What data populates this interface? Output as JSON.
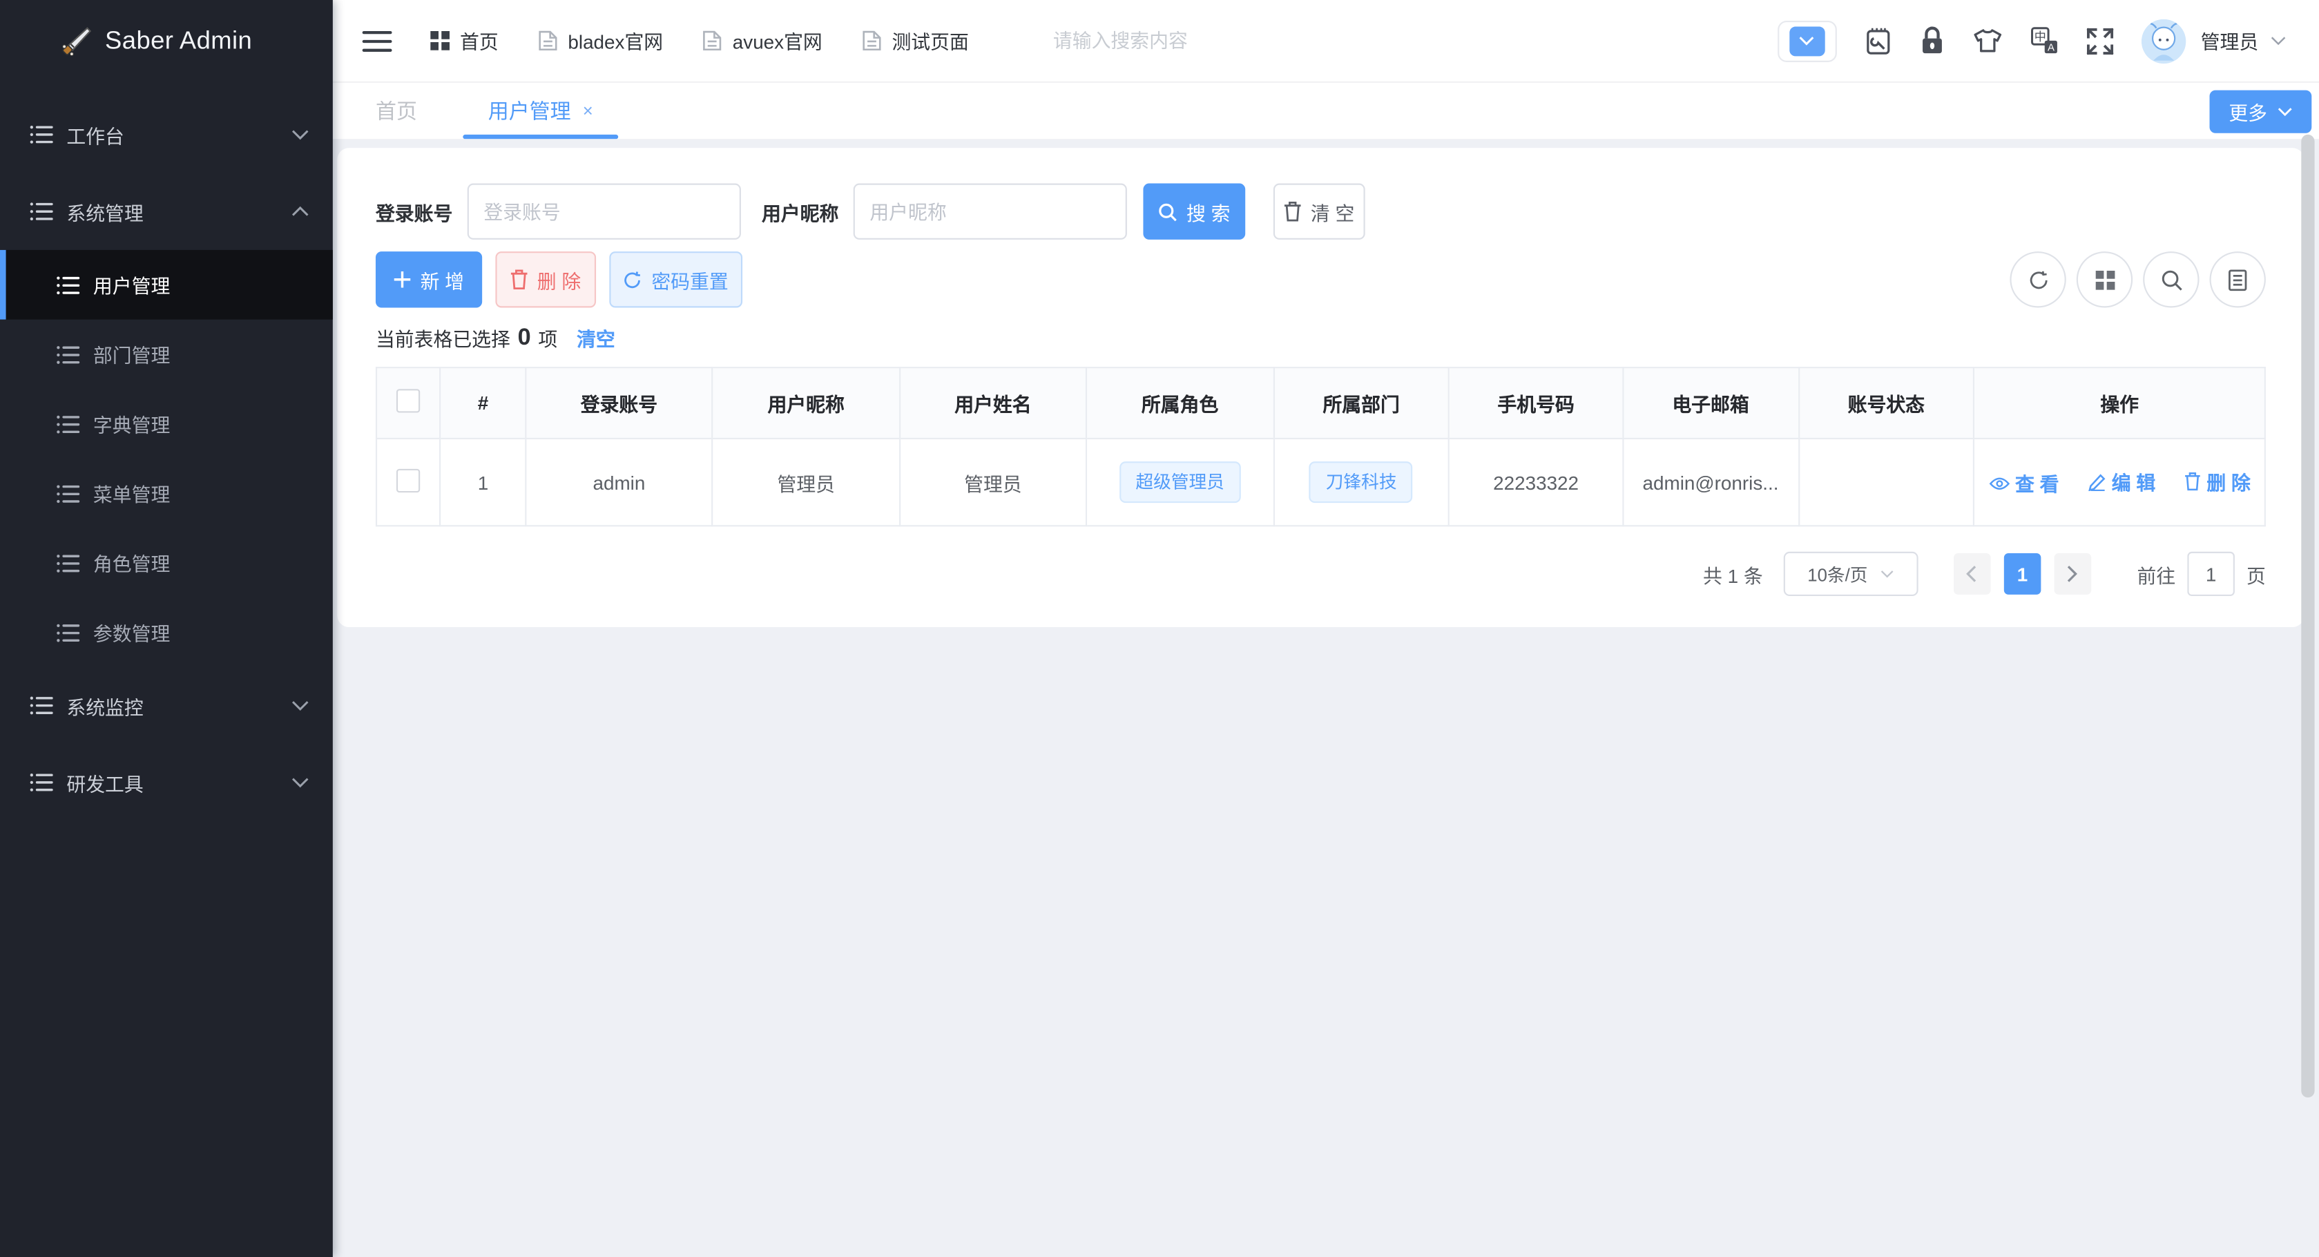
{
  "app": {
    "title": "Saber Admin"
  },
  "colors": {
    "accent": "#529bf8",
    "danger_text": "#ee6e6e",
    "sidebar_bg": "#20232c",
    "sidebar_active_bg": "#101115",
    "page_bg": "#eef0f5",
    "tag_bg": "#ecf5ff",
    "tag_border": "#d4e8fd"
  },
  "topnav": {
    "items": [
      {
        "label": "首页",
        "icon": "grid-icon"
      },
      {
        "label": "bladex官网",
        "icon": "doc-icon"
      },
      {
        "label": "avuex官网",
        "icon": "doc-icon"
      },
      {
        "label": "测试页面",
        "icon": "doc-icon"
      }
    ],
    "search_placeholder": "请输入搜索内容",
    "user_name": "管理员"
  },
  "tabs": {
    "items": [
      {
        "label": "首页",
        "active": false
      },
      {
        "label": "用户管理",
        "active": true,
        "close": "×"
      }
    ],
    "more_label": "更多"
  },
  "sidebar": {
    "items": [
      {
        "label": "工作台",
        "state": "collapsed"
      },
      {
        "label": "系统管理",
        "state": "expanded",
        "children": [
          {
            "label": "用户管理",
            "active": true
          },
          {
            "label": "部门管理",
            "active": false
          },
          {
            "label": "字典管理",
            "active": false
          },
          {
            "label": "菜单管理",
            "active": false
          },
          {
            "label": "角色管理",
            "active": false
          },
          {
            "label": "参数管理",
            "active": false
          }
        ]
      },
      {
        "label": "系统监控",
        "state": "collapsed"
      },
      {
        "label": "研发工具",
        "state": "collapsed"
      }
    ]
  },
  "filters": {
    "fields": [
      {
        "label": "登录账号",
        "placeholder": "登录账号",
        "value": ""
      },
      {
        "label": "用户昵称",
        "placeholder": "用户昵称",
        "value": ""
      }
    ],
    "search_label": "搜 索",
    "clear_label": "清 空"
  },
  "toolbar": {
    "add_label": "新 增",
    "delete_label": "删 除",
    "reset_pwd_label": "密码重置"
  },
  "selection": {
    "prefix": "当前表格已选择",
    "count": "0",
    "suffix": "项",
    "clear_label": "清空"
  },
  "table": {
    "headers": [
      "#",
      "登录账号",
      "用户昵称",
      "用户姓名",
      "所属角色",
      "所属部门",
      "手机号码",
      "电子邮箱",
      "账号状态",
      "操作"
    ],
    "rows": [
      {
        "index": "1",
        "account": "admin",
        "nickname": "管理员",
        "name": "管理员",
        "role": "超级管理员",
        "dept": "刀锋科技",
        "phone": "22233322",
        "email": "admin@ronris...",
        "status": "",
        "actions": {
          "view": "查 看",
          "edit": "编 辑",
          "delete": "删 除"
        }
      }
    ]
  },
  "pagination": {
    "total": "共 1 条",
    "page_size": "10条/页",
    "current_page": "1",
    "goto_label": "前往",
    "goto_value": "1",
    "page_unit": "页"
  }
}
